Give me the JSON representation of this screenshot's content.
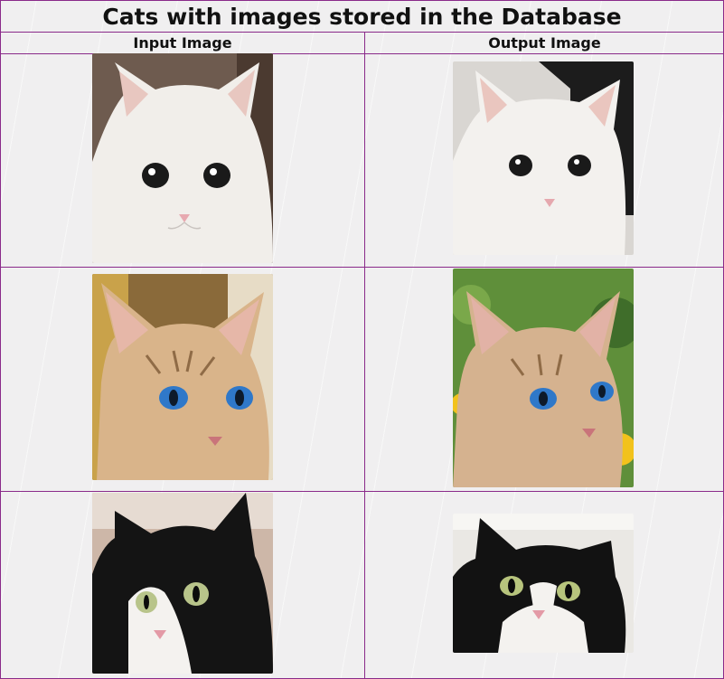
{
  "page": {
    "title": "Cats with images stored in the Database",
    "columns": [
      "Input Image",
      "Output Image"
    ]
  },
  "rows": [
    {
      "input": {
        "icon": "white-cat-photo"
      },
      "output": {
        "icon": "white-cat-photo"
      }
    },
    {
      "input": {
        "icon": "tabby-cat-blue-eyes-photo"
      },
      "output": {
        "icon": "tabby-cat-blue-eyes-photo"
      }
    },
    {
      "input": {
        "icon": "tuxedo-cat-photo"
      },
      "output": {
        "icon": "tuxedo-cat-photo"
      }
    }
  ],
  "colors": {
    "border": "#8a2a8a",
    "background": "#f0eff0"
  }
}
